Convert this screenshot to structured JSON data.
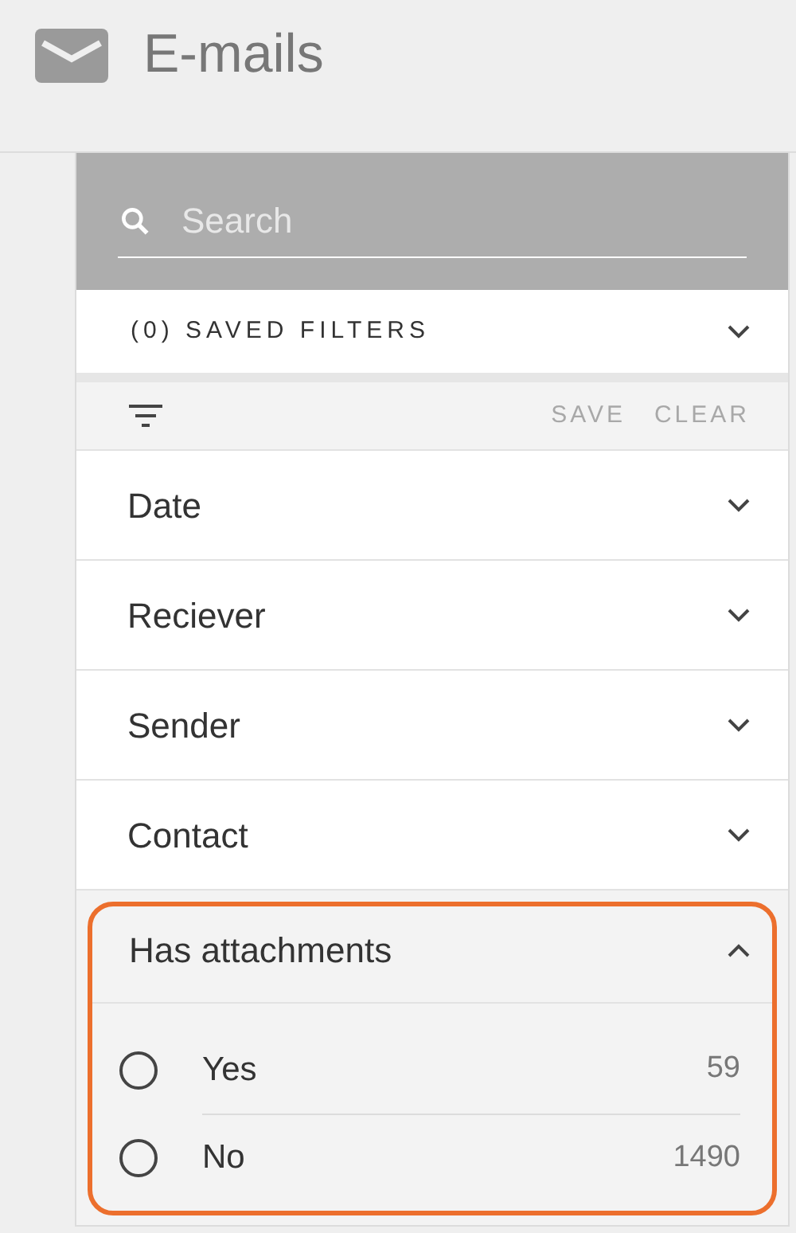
{
  "header": {
    "title": "E-mails"
  },
  "search": {
    "placeholder": "Search"
  },
  "saved_filters": {
    "label": "(0) SAVED FILTERS",
    "expanded": false
  },
  "toolbar": {
    "buttons": [
      {
        "label": "SAVE",
        "disabled": true
      },
      {
        "label": "CLEAR",
        "disabled": true
      }
    ]
  },
  "sections": [
    {
      "label": "Date",
      "expanded": false,
      "highlighted": false
    },
    {
      "label": "Reciever",
      "expanded": false,
      "highlighted": false
    },
    {
      "label": "Sender",
      "expanded": false,
      "highlighted": false
    },
    {
      "label": "Contact",
      "expanded": false,
      "highlighted": false
    },
    {
      "label": "Has attachments",
      "expanded": true,
      "highlighted": true,
      "options": [
        {
          "label": "Yes",
          "count": "59",
          "selected": false
        },
        {
          "label": "No",
          "count": "1490",
          "selected": false
        }
      ]
    }
  ]
}
